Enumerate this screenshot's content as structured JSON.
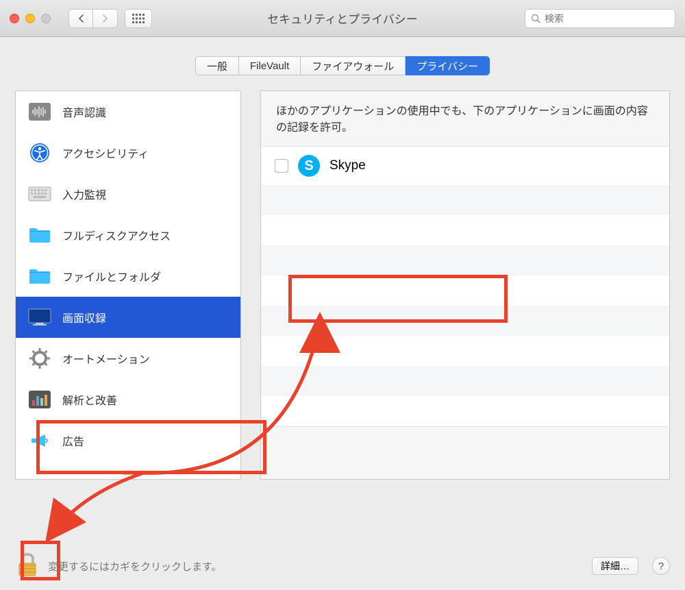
{
  "window": {
    "title": "セキュリティとプライバシー",
    "search_placeholder": "検索"
  },
  "tabs": {
    "general": "一般",
    "filevault": "FileVault",
    "firewall": "ファイアウォール",
    "privacy": "プライバシー"
  },
  "sidebar": {
    "items": [
      {
        "label": "音声認識"
      },
      {
        "label": "アクセシビリティ"
      },
      {
        "label": "入力監視"
      },
      {
        "label": "フルディスクアクセス"
      },
      {
        "label": "ファイルとフォルダ"
      },
      {
        "label": "画面収録"
      },
      {
        "label": "オートメーション"
      },
      {
        "label": "解析と改善"
      },
      {
        "label": "広告"
      }
    ]
  },
  "main": {
    "description": "ほかのアプリケーションの使用中でも、下のアプリケーションに画面の内容の記録を許可。",
    "apps": [
      {
        "name": "Skype"
      }
    ]
  },
  "footer": {
    "lock_text": "変更するにはカギをクリックします。",
    "details": "詳細…",
    "help": "?"
  }
}
